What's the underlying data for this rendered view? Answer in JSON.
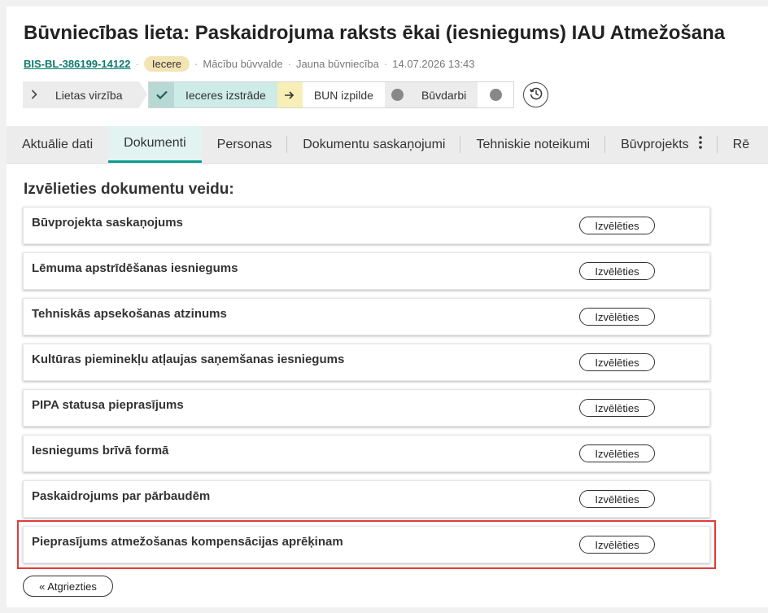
{
  "header": {
    "title": "Būvniecības lieta: Paskaidrojuma raksts ēkai (iesniegums) IAU Atmežošana",
    "case_id": "BIS-BL-386199-14122",
    "status_badge": "Iecere",
    "sep": "·",
    "authority": "Mācību būvvalde",
    "case_type": "Jauna būvniecība",
    "datetime": "14.07.2026 13:43"
  },
  "stepper": {
    "back_label": "Lietas virzība",
    "steps": [
      {
        "label": "Ieceres izstrāde",
        "state": "done",
        "icon": "check-icon"
      },
      {
        "label": "BUN izpilde",
        "state": "active",
        "icon": "arrow-right-icon"
      },
      {
        "label": "Būvdarbi",
        "state": "todo",
        "icon": "dot-icon"
      }
    ],
    "history_icon": "history-icon"
  },
  "tabs": [
    {
      "label": "Aktuālie dati",
      "active": false
    },
    {
      "label": "Dokumenti",
      "active": true
    },
    {
      "label": "Personas",
      "active": false
    },
    {
      "label": "Dokumentu saskaņojumi",
      "active": false
    },
    {
      "label": "Tehniskie noteikumi",
      "active": false
    },
    {
      "label": "Būvprojekts",
      "active": false
    },
    {
      "label": "Rē",
      "active": false
    }
  ],
  "main": {
    "section_title": "Izvēlieties dokumentu veidu:",
    "select_label": "Izvēlēties",
    "documents": [
      {
        "name": "Būvprojekta saskaņojums"
      },
      {
        "name": "Lēmuma apstrīdēšanas iesniegums"
      },
      {
        "name": "Tehniskās apsekošanas atzinums"
      },
      {
        "name": "Kultūras pieminekļu atļaujas saņemšanas iesniegums"
      },
      {
        "name": "PIPA statusa pieprasījums"
      },
      {
        "name": "Iesniegums brīvā formā"
      },
      {
        "name": "Paskaidrojums par pārbaudēm"
      },
      {
        "name": "Pieprasījums atmežošanas kompensācijas aprēķinam"
      }
    ],
    "highlighted_index": 7,
    "back_button": "« Atgriezties"
  },
  "colors": {
    "accent": "#0b9d8e",
    "link": "#0b7a6e",
    "badge_bg": "#f3e4b3",
    "highlight_border": "#e03b3b"
  }
}
